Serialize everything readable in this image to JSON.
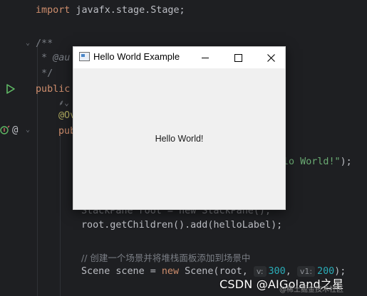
{
  "editor": {
    "line_import_kw": "import",
    "line_import_rest": " javafx.stage.Stage;",
    "doc_open": "/**",
    "doc_author": " * @au",
    "doc_close": " */",
    "class_kw": "public",
    "override_partial": "@Ov",
    "method_partial": "pub",
    "cut_string": "lo World!\"",
    "cut_string_end": ");",
    "stackpane_line": "StackPane root = new StackPane();",
    "add_line_a": "root.getChildren().add(",
    "add_line_b": "helloLabel",
    "add_line_c": ");",
    "comment_line": "// 创建一个场景并将堆栈面板添加到场景中",
    "scene_kw1": "Scene scene = ",
    "scene_new": "new",
    "scene_rest": " Scene(root, ",
    "hint_v": "v:",
    "val_300": "300",
    "hint_v1": "v1:",
    "val_200": "200",
    "scene_end": ");"
  },
  "dialog": {
    "title": "Hello World Example",
    "label": "Hello World!",
    "app_icon": "java-window-icon",
    "minimize_icon": "minimize-icon",
    "maximize_icon": "maximize-icon",
    "close_icon": "close-icon"
  },
  "watermark": {
    "text": "CSDN @AIGoland之星",
    "sub": "@稀土掘金技术社区"
  },
  "colors": {
    "editor_bg": "#1e1f22",
    "keyword": "#cf8e6d",
    "comment": "#7a7e85",
    "annotation": "#b3ae60",
    "string": "#6aab73",
    "number": "#2aacb8"
  }
}
